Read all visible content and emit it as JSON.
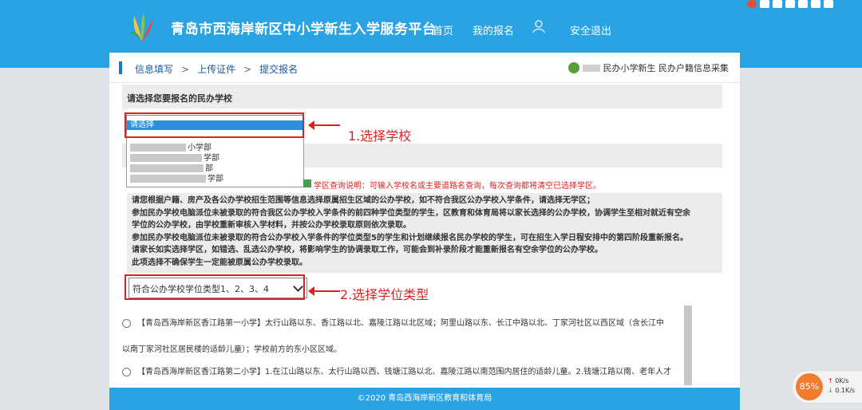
{
  "header": {
    "site_title": "青岛市西海岸新区中小学新生入学服务平台",
    "nav_home": "首页",
    "nav_my": "我的报名",
    "nav_logout": "安全退出"
  },
  "breadcrumb": {
    "step1": "信息填写",
    "step2": "上传证件",
    "step3": "提交报名",
    "sep": ">",
    "right_text": "民办小学新生 民办户籍信息采集"
  },
  "form": {
    "section_title": "请选择您要报名的民办学校",
    "select_placeholder": "请选择",
    "dropdown_options": [
      "小学部",
      "学部",
      "部",
      "学部"
    ],
    "search_hint": "学区查询说明：可输入学校名或主要道路名查询，每次查询都将清空已选择学区。",
    "info_lines": [
      "请您根据户籍、房产及各公办学校招生范围等信息选择原属招生区域的公办学校，如不符合我区公办学校入学条件，请选择无学区；",
      "参加民办学校电脑派位未被录取的符合我区公办学校入学条件的前四种学位类型的学生，区教育和体育局将以家长选择的公办学校，协调学生至相对就近有空余",
      "学位的公办学校，由学校重新审核入学材料，并按公办学校录取原则依次录取。",
      "参加民办学校电脑派位未被录取的符合公办学校入学条件的学位类型5的学生和计划继续报名民办学校的学生，可在招生入学日程安排中的第四阶段重新报名。",
      "请家长如实选择学区，如错选、乱选公办学校，将影响学生的协调录取工作，可能会到补录阶段才能重新报名有空余学位的公办学校。",
      "此项选择不确保学生一定能被原属公办学校录取。"
    ],
    "type_select_value": "符合公办学校学位类型1、2、3、4"
  },
  "annotations": {
    "step1": "1.选择学校",
    "step2": "2.选择学位类型"
  },
  "schools": [
    {
      "line1": "【青岛西海岸新区香江路第一小学】太行山路以东、香江路以北、嘉陵江路以北区域；阿里山路以东、长江中路以北、丁家河社区以西区域（含长江中",
      "line2": "以南丁家河社区居民楼的适龄儿童）；学校前方的东小区区域。"
    },
    {
      "line1": "【青岛西海岸新区香江路第二小学】1.在江山路以东、太行山路以西、钱塘江路以北、嘉陵江路以南范围内居住的适龄儿童。2.钱塘江路以南、老年人才"
    }
  ],
  "footer": {
    "copyright": "©2020 青岛西海岸新区教育和体育局"
  },
  "widget": {
    "percent": "85%",
    "up": "0K/s",
    "down": "0.1K/s"
  },
  "colors": {
    "header_blue": "#29a3e4",
    "annotation_red": "#e02020"
  }
}
